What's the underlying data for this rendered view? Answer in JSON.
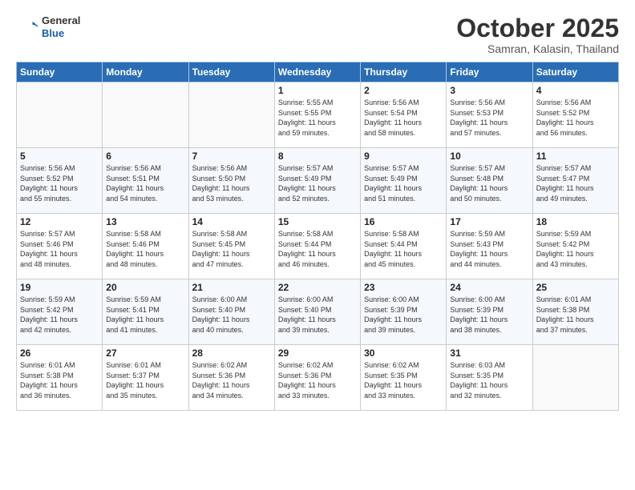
{
  "header": {
    "logo_line1": "General",
    "logo_line2": "Blue",
    "month": "October 2025",
    "location": "Samran, Kalasin, Thailand"
  },
  "weekdays": [
    "Sunday",
    "Monday",
    "Tuesday",
    "Wednesday",
    "Thursday",
    "Friday",
    "Saturday"
  ],
  "weeks": [
    [
      {
        "day": "",
        "text": ""
      },
      {
        "day": "",
        "text": ""
      },
      {
        "day": "",
        "text": ""
      },
      {
        "day": "1",
        "text": "Sunrise: 5:55 AM\nSunset: 5:55 PM\nDaylight: 11 hours\nand 59 minutes."
      },
      {
        "day": "2",
        "text": "Sunrise: 5:56 AM\nSunset: 5:54 PM\nDaylight: 11 hours\nand 58 minutes."
      },
      {
        "day": "3",
        "text": "Sunrise: 5:56 AM\nSunset: 5:53 PM\nDaylight: 11 hours\nand 57 minutes."
      },
      {
        "day": "4",
        "text": "Sunrise: 5:56 AM\nSunset: 5:52 PM\nDaylight: 11 hours\nand 56 minutes."
      }
    ],
    [
      {
        "day": "5",
        "text": "Sunrise: 5:56 AM\nSunset: 5:52 PM\nDaylight: 11 hours\nand 55 minutes."
      },
      {
        "day": "6",
        "text": "Sunrise: 5:56 AM\nSunset: 5:51 PM\nDaylight: 11 hours\nand 54 minutes."
      },
      {
        "day": "7",
        "text": "Sunrise: 5:56 AM\nSunset: 5:50 PM\nDaylight: 11 hours\nand 53 minutes."
      },
      {
        "day": "8",
        "text": "Sunrise: 5:57 AM\nSunset: 5:49 PM\nDaylight: 11 hours\nand 52 minutes."
      },
      {
        "day": "9",
        "text": "Sunrise: 5:57 AM\nSunset: 5:49 PM\nDaylight: 11 hours\nand 51 minutes."
      },
      {
        "day": "10",
        "text": "Sunrise: 5:57 AM\nSunset: 5:48 PM\nDaylight: 11 hours\nand 50 minutes."
      },
      {
        "day": "11",
        "text": "Sunrise: 5:57 AM\nSunset: 5:47 PM\nDaylight: 11 hours\nand 49 minutes."
      }
    ],
    [
      {
        "day": "12",
        "text": "Sunrise: 5:57 AM\nSunset: 5:46 PM\nDaylight: 11 hours\nand 48 minutes."
      },
      {
        "day": "13",
        "text": "Sunrise: 5:58 AM\nSunset: 5:46 PM\nDaylight: 11 hours\nand 48 minutes."
      },
      {
        "day": "14",
        "text": "Sunrise: 5:58 AM\nSunset: 5:45 PM\nDaylight: 11 hours\nand 47 minutes."
      },
      {
        "day": "15",
        "text": "Sunrise: 5:58 AM\nSunset: 5:44 PM\nDaylight: 11 hours\nand 46 minutes."
      },
      {
        "day": "16",
        "text": "Sunrise: 5:58 AM\nSunset: 5:44 PM\nDaylight: 11 hours\nand 45 minutes."
      },
      {
        "day": "17",
        "text": "Sunrise: 5:59 AM\nSunset: 5:43 PM\nDaylight: 11 hours\nand 44 minutes."
      },
      {
        "day": "18",
        "text": "Sunrise: 5:59 AM\nSunset: 5:42 PM\nDaylight: 11 hours\nand 43 minutes."
      }
    ],
    [
      {
        "day": "19",
        "text": "Sunrise: 5:59 AM\nSunset: 5:42 PM\nDaylight: 11 hours\nand 42 minutes."
      },
      {
        "day": "20",
        "text": "Sunrise: 5:59 AM\nSunset: 5:41 PM\nDaylight: 11 hours\nand 41 minutes."
      },
      {
        "day": "21",
        "text": "Sunrise: 6:00 AM\nSunset: 5:40 PM\nDaylight: 11 hours\nand 40 minutes."
      },
      {
        "day": "22",
        "text": "Sunrise: 6:00 AM\nSunset: 5:40 PM\nDaylight: 11 hours\nand 39 minutes."
      },
      {
        "day": "23",
        "text": "Sunrise: 6:00 AM\nSunset: 5:39 PM\nDaylight: 11 hours\nand 39 minutes."
      },
      {
        "day": "24",
        "text": "Sunrise: 6:00 AM\nSunset: 5:39 PM\nDaylight: 11 hours\nand 38 minutes."
      },
      {
        "day": "25",
        "text": "Sunrise: 6:01 AM\nSunset: 5:38 PM\nDaylight: 11 hours\nand 37 minutes."
      }
    ],
    [
      {
        "day": "26",
        "text": "Sunrise: 6:01 AM\nSunset: 5:38 PM\nDaylight: 11 hours\nand 36 minutes."
      },
      {
        "day": "27",
        "text": "Sunrise: 6:01 AM\nSunset: 5:37 PM\nDaylight: 11 hours\nand 35 minutes."
      },
      {
        "day": "28",
        "text": "Sunrise: 6:02 AM\nSunset: 5:36 PM\nDaylight: 11 hours\nand 34 minutes."
      },
      {
        "day": "29",
        "text": "Sunrise: 6:02 AM\nSunset: 5:36 PM\nDaylight: 11 hours\nand 33 minutes."
      },
      {
        "day": "30",
        "text": "Sunrise: 6:02 AM\nSunset: 5:35 PM\nDaylight: 11 hours\nand 33 minutes."
      },
      {
        "day": "31",
        "text": "Sunrise: 6:03 AM\nSunset: 5:35 PM\nDaylight: 11 hours\nand 32 minutes."
      },
      {
        "day": "",
        "text": ""
      }
    ]
  ]
}
